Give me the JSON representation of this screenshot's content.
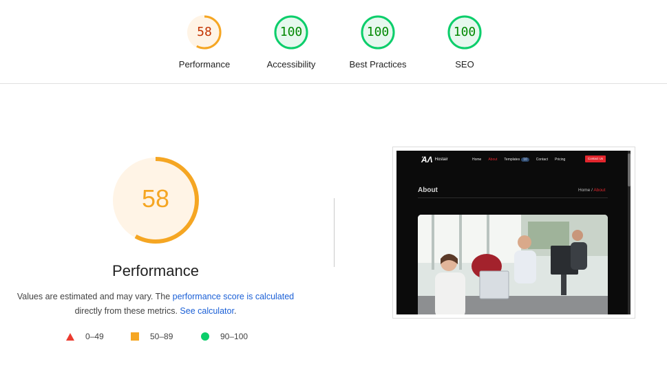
{
  "gauges": [
    {
      "label": "Performance",
      "score": "58",
      "value": 0.58,
      "status": "average"
    },
    {
      "label": "Accessibility",
      "score": "100",
      "value": 1.0,
      "status": "pass"
    },
    {
      "label": "Best Practices",
      "score": "100",
      "value": 1.0,
      "status": "pass"
    },
    {
      "label": "SEO",
      "score": "100",
      "value": 1.0,
      "status": "pass"
    }
  ],
  "colors": {
    "average_stroke": "#f5a623",
    "average_text": "#c33300",
    "average_fill": "#fff4e6",
    "pass_stroke": "#0cce6b",
    "pass_text": "#008800",
    "pass_fill": "#e6f8ee",
    "fail": "#eb3b30",
    "link": "#1a5fd6"
  },
  "main": {
    "score": "58",
    "value": 0.58,
    "title": "Performance",
    "desc_part1": "Values are estimated and may vary. The ",
    "desc_link1": "performance score is calculated",
    "desc_part2": " directly from these metrics. ",
    "desc_link2": "See calculator",
    "desc_part3": "."
  },
  "legend": [
    {
      "icon": "triangle-icon",
      "label": "0–49"
    },
    {
      "icon": "square-icon",
      "label": "50–89"
    },
    {
      "icon": "circle-icon",
      "label": "90–100"
    }
  ],
  "screenshot": {
    "logo": "Hostair",
    "nav": [
      "Home",
      "About",
      "Templates",
      "Contact",
      "Pricing"
    ],
    "templates_badge": "10",
    "cta": "Contact Us",
    "heading": "About",
    "breadcrumb_home": "Home",
    "breadcrumb_sep": " / ",
    "breadcrumb_current": "About"
  }
}
